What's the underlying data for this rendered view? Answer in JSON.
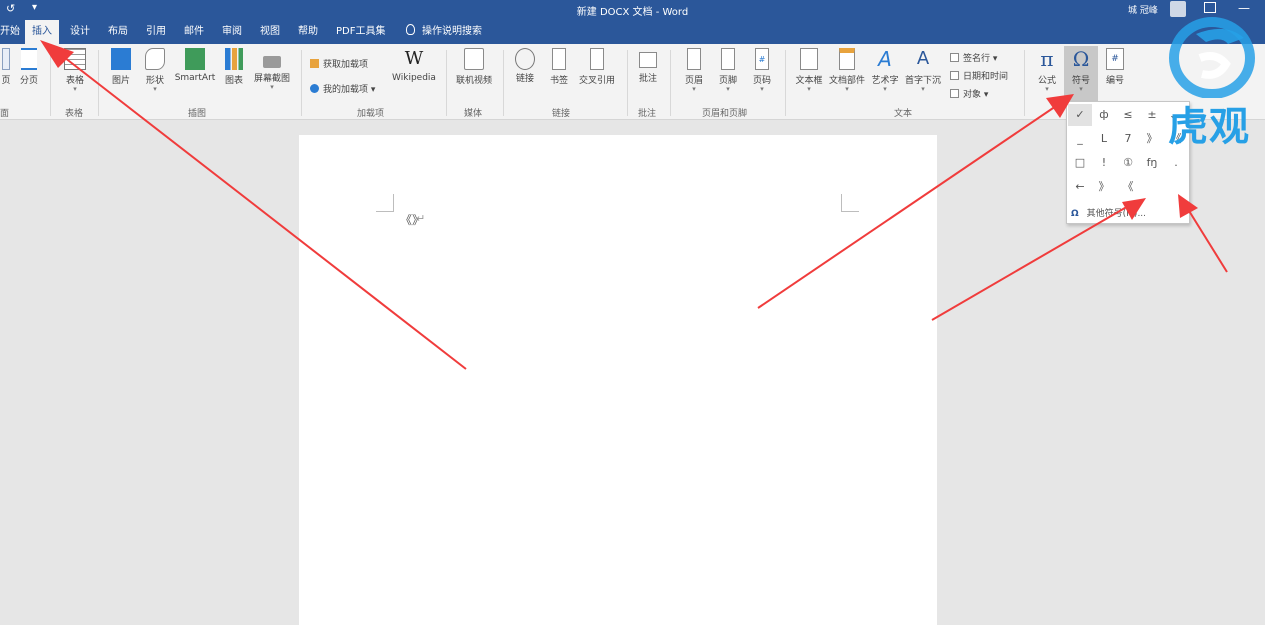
{
  "titlebar": {
    "quick_access_1": "↺",
    "quick_access_2": "▾",
    "title": "新建 DOCX 文档 - Word",
    "user": "城 冠峰",
    "minimize": "—"
  },
  "tabs": {
    "home": "开始",
    "insert": "插入",
    "design": "设计",
    "layout": "布局",
    "references": "引用",
    "mailings": "邮件",
    "review": "审阅",
    "view": "视图",
    "help": "帮助",
    "pdf": "PDF工具集",
    "tell_me": "操作说明搜索"
  },
  "ribbon": {
    "page_partial": "页",
    "page_break": "分页",
    "table": "表格",
    "picture": "图片",
    "shapes": "形状",
    "smartart": "SmartArt",
    "chart": "图表",
    "screenshot": "屏幕截图",
    "get_addins": "获取加载项",
    "my_addins": "我的加载项",
    "wikipedia": "Wikipedia",
    "online_video": "联机视频",
    "link": "链接",
    "bookmark": "书签",
    "cross_ref": "交叉引用",
    "comment": "批注",
    "header": "页眉",
    "footer": "页脚",
    "page_number": "页码",
    "textbox": "文本框",
    "quick_parts": "文档部件",
    "wordart": "艺术字",
    "dropcap": "首字下沉",
    "signature": "签名行",
    "datetime": "日期和时间",
    "object": "对象",
    "equation": "公式",
    "symbol": "符号",
    "numbering": "编号",
    "w_glyph": "W",
    "pi_glyph": "π",
    "omega_glyph": "Ω",
    "number_glyph": "#",
    "dropdown_glyph": "▾"
  },
  "groups": {
    "pages_partial": "面",
    "tables": "表格",
    "illustrations": "插图",
    "addins": "加载项",
    "media": "媒体",
    "links": "链接",
    "comments": "批注",
    "header_footer": "页眉和页脚",
    "text": "文本"
  },
  "document": {
    "inserted_text": "《》"
  },
  "symbol_dropdown": {
    "symbols": [
      "✓",
      "ф",
      "≤",
      "±",
      "、",
      "_",
      "L",
      "7",
      "》",
      "《",
      "□",
      "!",
      "①",
      "fŋ",
      ".",
      "←",
      "》",
      "《"
    ],
    "more_icon": "Ω",
    "more_label": "其他符号(M)..."
  },
  "watermark": {
    "brand": "虎观"
  },
  "colors": {
    "word_blue": "#2b579a",
    "arrow_red": "#f03c3c",
    "brand_blue": "#27a0e6"
  }
}
